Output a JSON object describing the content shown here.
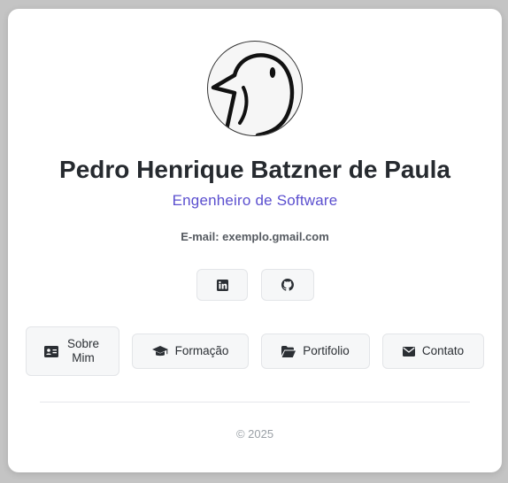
{
  "profile": {
    "name": "Pedro Henrique Batzner de Paula",
    "role": "Engenheiro de Software",
    "email_text": "E-mail: exemplo.gmail.com",
    "avatar_icon": "bird-logo-icon"
  },
  "social": [
    {
      "icon": "linkedin-icon"
    },
    {
      "icon": "github-icon"
    }
  ],
  "nav": {
    "sobre": {
      "label": "Sobre Mim",
      "icon": "id-card-icon"
    },
    "formacao": {
      "label": "Formação",
      "icon": "graduation-cap-icon"
    },
    "portfolio": {
      "label": "Portifolio",
      "icon": "folder-open-icon"
    },
    "contato": {
      "label": "Contato",
      "icon": "envelope-icon"
    }
  },
  "footer": {
    "text": "© 2025"
  },
  "colors": {
    "accent": "#5b4fcf",
    "name": "#262a2f",
    "background": "#c4c4c4"
  }
}
